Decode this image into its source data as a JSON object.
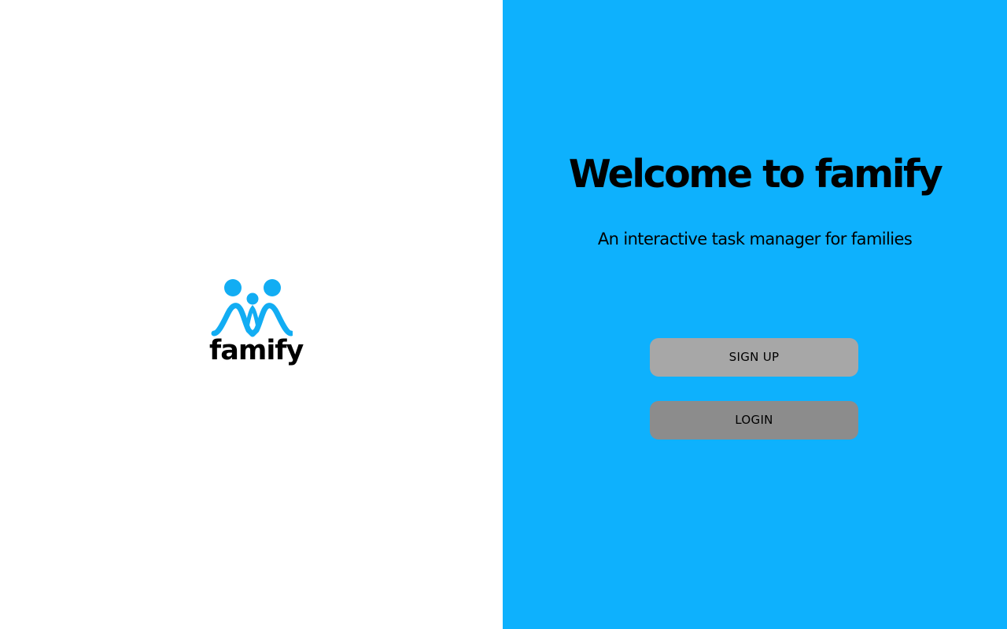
{
  "colors": {
    "left_background": "#ffffff",
    "right_background": "#0eb1fd",
    "logo_blue": "#12adf3",
    "signup_button": "#a7a7a7",
    "login_button": "#8c8c8c"
  },
  "logo": {
    "icon": "family-figures-icon",
    "wordmark": "famify"
  },
  "welcome": {
    "title": "Welcome to famify",
    "subtitle": "An interactive task manager for families"
  },
  "actions": {
    "signup_label": "SIGN UP",
    "login_label": "LOGIN"
  }
}
